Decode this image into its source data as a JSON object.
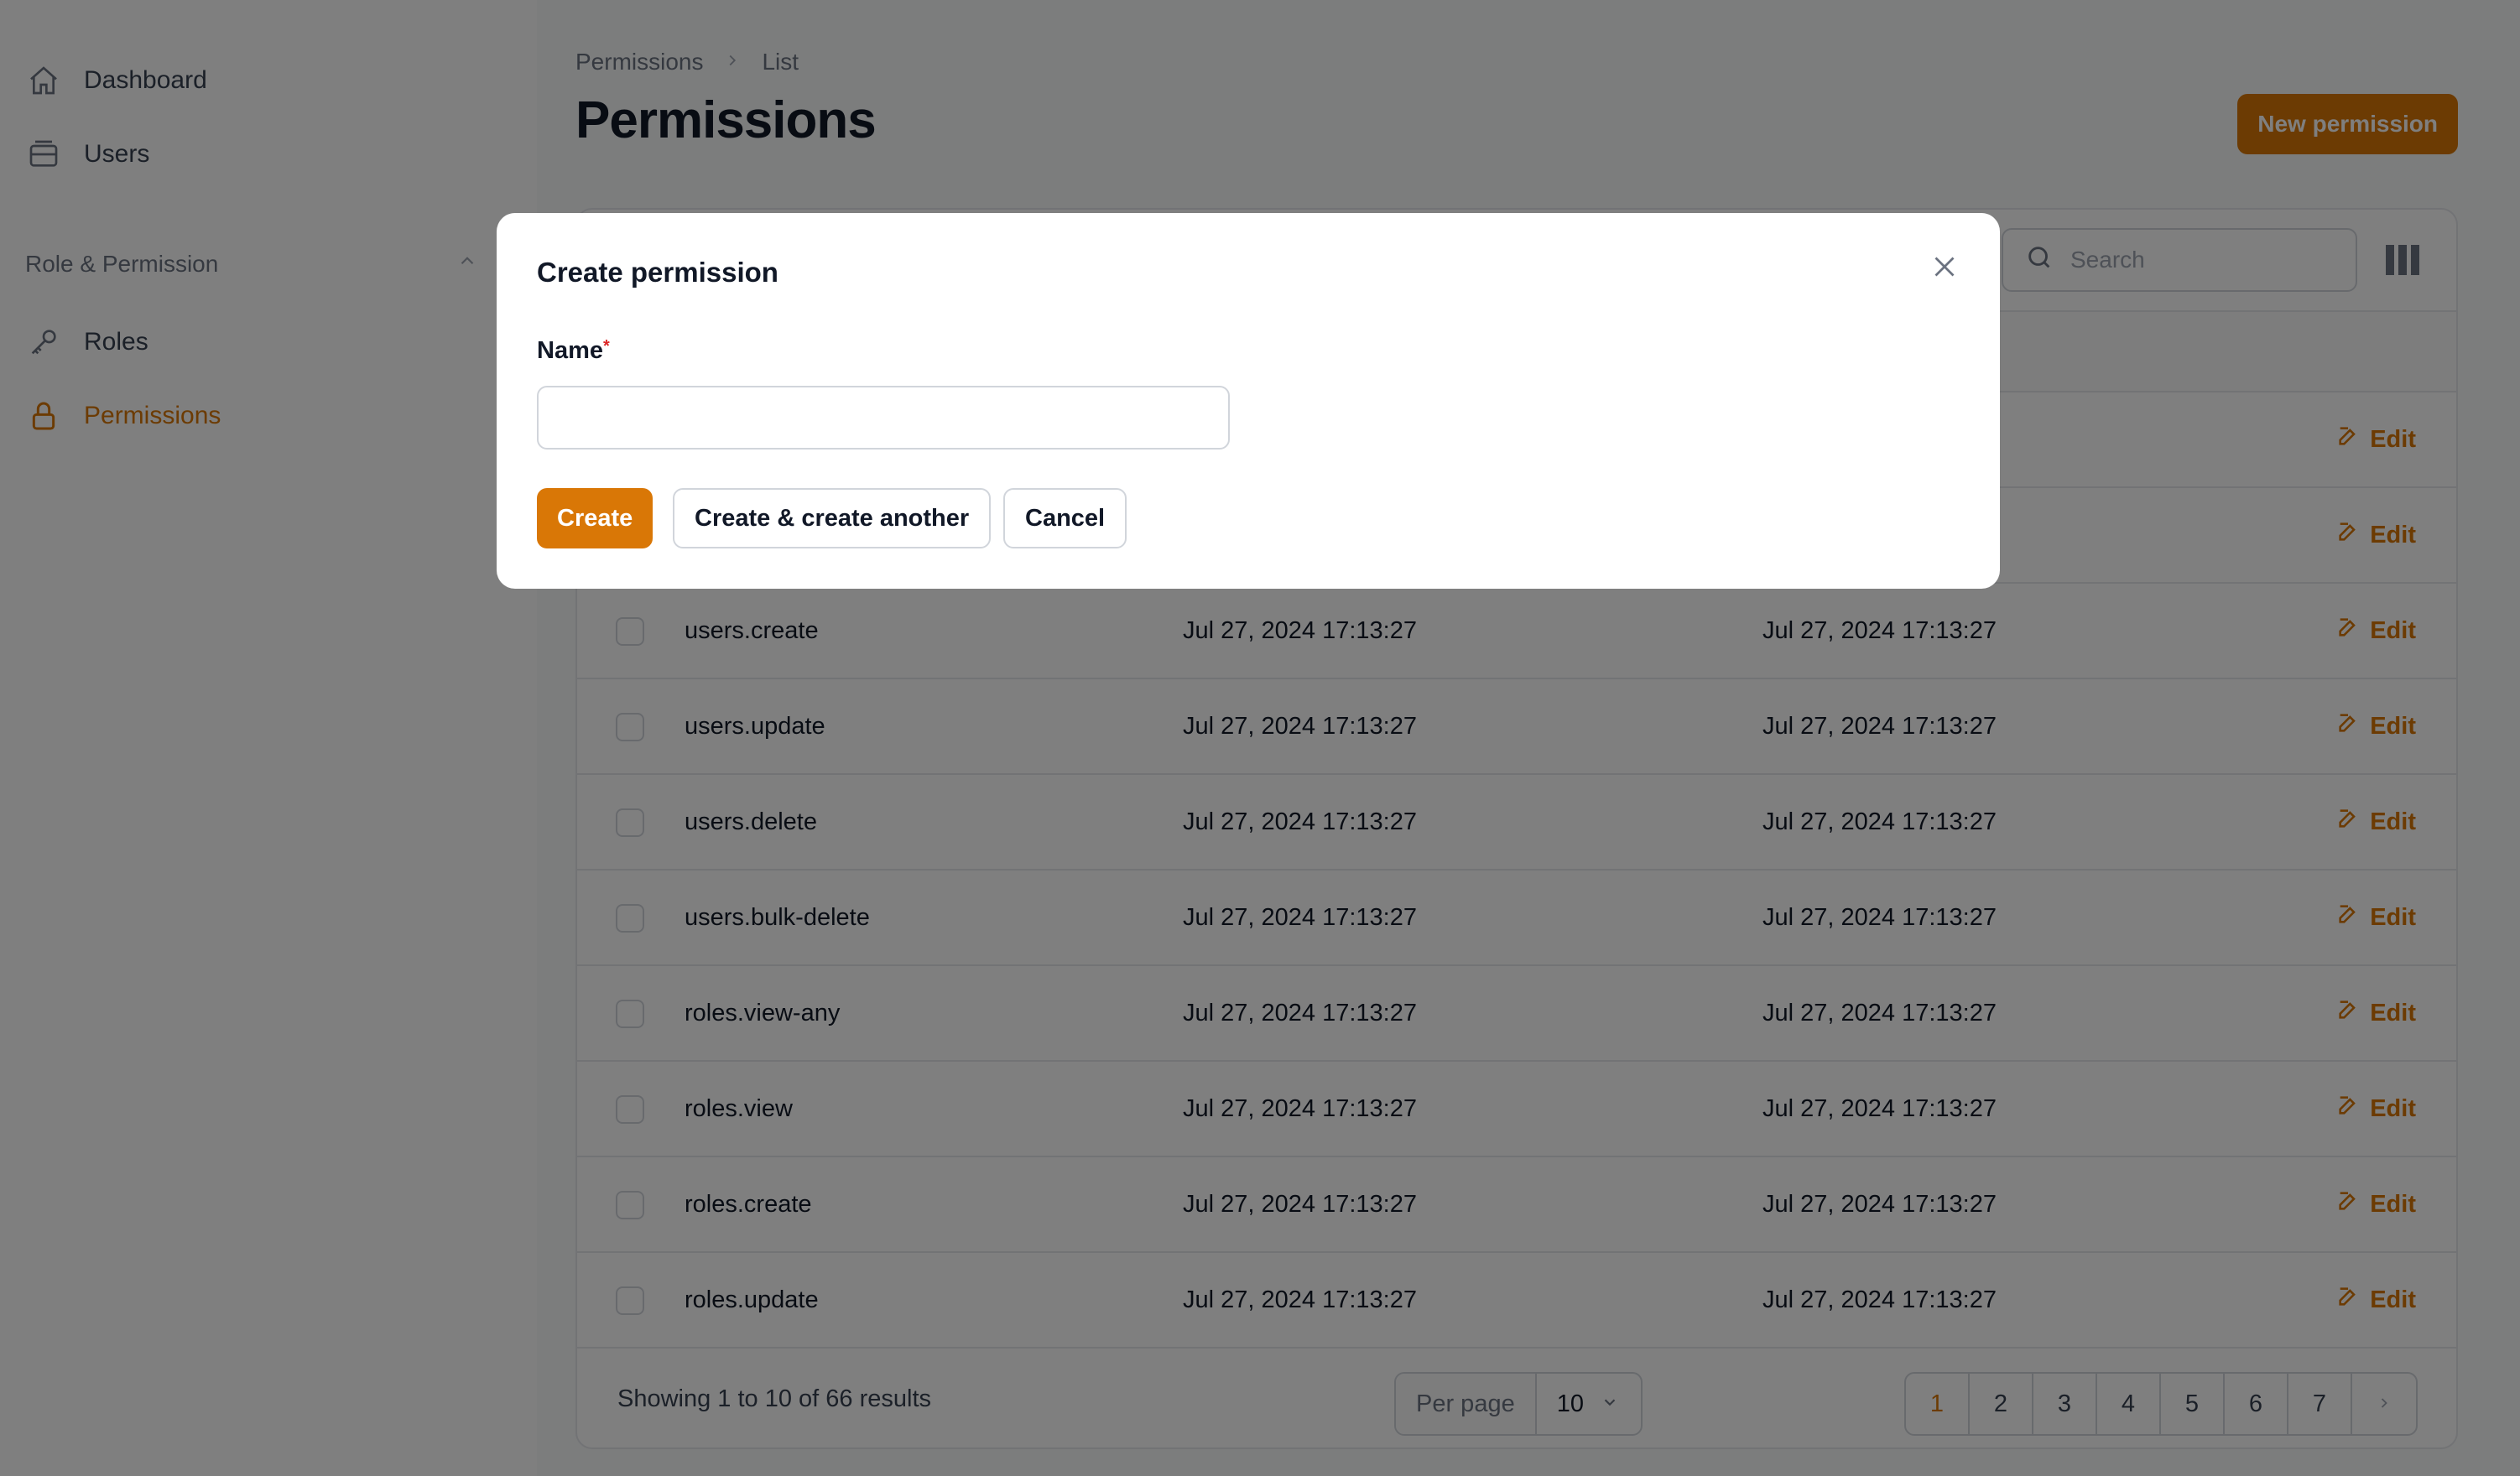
{
  "sidebar": {
    "items": [
      {
        "label": "Dashboard",
        "icon": "home-icon"
      },
      {
        "label": "Users",
        "icon": "inbox-icon"
      }
    ],
    "group": {
      "label": "Role & Permission",
      "icon": "chevron-up-icon"
    },
    "group_items": [
      {
        "label": "Roles",
        "icon": "key-icon"
      },
      {
        "label": "Permissions",
        "icon": "lock-icon",
        "active": true
      }
    ]
  },
  "header": {
    "breadcrumb": [
      "Permissions",
      "List"
    ],
    "title": "Permissions",
    "new_button": "New permission"
  },
  "table": {
    "search_placeholder": "Search",
    "edit_label": "Edit",
    "rows": [
      {
        "name": "",
        "created": "",
        "updated": ""
      },
      {
        "name": "",
        "created": "",
        "updated": ""
      },
      {
        "name": "users.create",
        "created": "Jul 27, 2024 17:13:27",
        "updated": "Jul 27, 2024 17:13:27"
      },
      {
        "name": "users.update",
        "created": "Jul 27, 2024 17:13:27",
        "updated": "Jul 27, 2024 17:13:27"
      },
      {
        "name": "users.delete",
        "created": "Jul 27, 2024 17:13:27",
        "updated": "Jul 27, 2024 17:13:27"
      },
      {
        "name": "users.bulk-delete",
        "created": "Jul 27, 2024 17:13:27",
        "updated": "Jul 27, 2024 17:13:27"
      },
      {
        "name": "roles.view-any",
        "created": "Jul 27, 2024 17:13:27",
        "updated": "Jul 27, 2024 17:13:27"
      },
      {
        "name": "roles.view",
        "created": "Jul 27, 2024 17:13:27",
        "updated": "Jul 27, 2024 17:13:27"
      },
      {
        "name": "roles.create",
        "created": "Jul 27, 2024 17:13:27",
        "updated": "Jul 27, 2024 17:13:27"
      },
      {
        "name": "roles.update",
        "created": "Jul 27, 2024 17:13:27",
        "updated": "Jul 27, 2024 17:13:27"
      }
    ],
    "showing": "Showing 1 to 10 of 66 results",
    "per_page_label": "Per page",
    "per_page_value": "10",
    "pages": [
      "1",
      "2",
      "3",
      "4",
      "5",
      "6",
      "7"
    ],
    "current_page": "1"
  },
  "modal": {
    "title": "Create permission",
    "name_label": "Name",
    "required_mark": "*",
    "name_value": "",
    "create": "Create",
    "create_another": "Create & create another",
    "cancel": "Cancel"
  },
  "colors": {
    "accent": "#d97706",
    "overlay": "rgba(0,0,0,0.5)"
  }
}
